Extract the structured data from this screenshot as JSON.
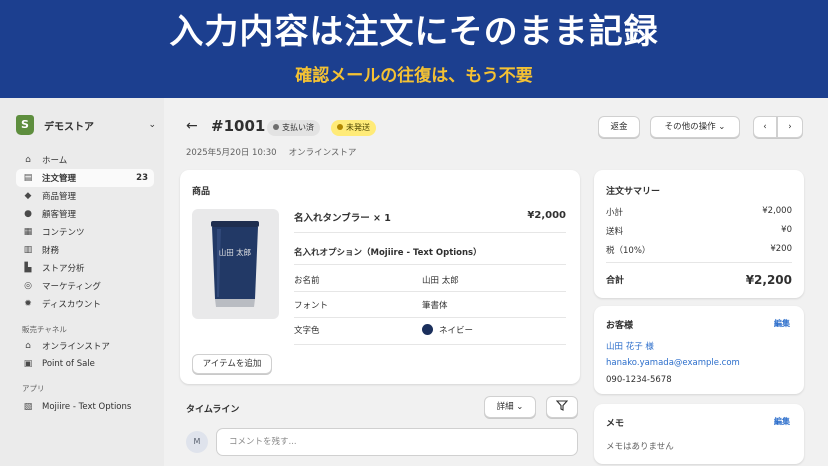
{
  "banner": {
    "title": "入力内容は注文にそのまま記録",
    "subtitle": "確認メールの往復は、もう不要"
  },
  "colors": {
    "banner_bg": "#1c3f8f",
    "banner_subtitle": "#f5c233",
    "link": "#2c6ecb",
    "brand_green": "#5e8e3e"
  },
  "sidebar": {
    "store_name": "デモストア",
    "nav": [
      {
        "label": "ホーム",
        "icon": "home-icon"
      },
      {
        "label": "注文管理",
        "icon": "orders-icon",
        "count": "23",
        "active": true
      },
      {
        "label": "商品管理",
        "icon": "tag-icon"
      },
      {
        "label": "顧客管理",
        "icon": "person-icon"
      },
      {
        "label": "コンテンツ",
        "icon": "content-icon"
      },
      {
        "label": "財務",
        "icon": "bank-icon"
      },
      {
        "label": "ストア分析",
        "icon": "chart-icon"
      },
      {
        "label": "マーケティング",
        "icon": "target-icon"
      },
      {
        "label": "ディスカウント",
        "icon": "discount-icon"
      }
    ],
    "sales_channels_title": "販売チャネル",
    "sales_channels": [
      {
        "label": "オンラインストア",
        "icon": "store-icon"
      },
      {
        "label": "Point of Sale",
        "icon": "pos-icon"
      }
    ],
    "apps_title": "アプリ",
    "apps": [
      {
        "label": "Mojiire - Text Options",
        "icon": "app-icon"
      }
    ]
  },
  "order": {
    "id": "#1001",
    "payment_status": "支払い済",
    "fulfillment_status": "未発送",
    "date": "2025年5月20日 10:30",
    "source": "オンラインストア",
    "refund_label": "返金",
    "more_actions_label": "その他の操作"
  },
  "products": {
    "title": "商品",
    "item_name": "名入れタンブラー × 1",
    "item_price": "¥2,000",
    "engraving": "山田 太郎",
    "options_title": "名入れオプション（Mojiire - Text Options）",
    "options": [
      {
        "label": "お名前",
        "value": "山田 太郎"
      },
      {
        "label": "フォント",
        "value": "筆書体"
      },
      {
        "label": "文字色",
        "value": "ネイビー",
        "swatch": "#1b2f5c"
      }
    ],
    "add_item_label": "アイテムを追加"
  },
  "timeline": {
    "title": "タイムライン",
    "detail_label": "詳細",
    "avatar_initial": "M",
    "comment_placeholder": "コメントを残す..."
  },
  "summary": {
    "title": "注文サマリー",
    "rows": [
      {
        "label": "小計",
        "value": "¥2,000"
      },
      {
        "label": "送料",
        "value": "¥0"
      },
      {
        "label": "税（10%）",
        "value": "¥200"
      }
    ],
    "total_label": "合計",
    "total_value": "¥2,200"
  },
  "customer": {
    "title": "お客様",
    "edit_label": "編集",
    "name": "山田 花子 様",
    "email": "hanako.yamada@example.com",
    "phone": "090-1234-5678"
  },
  "memo": {
    "title": "メモ",
    "edit_label": "編集",
    "text": "メモはありません"
  }
}
